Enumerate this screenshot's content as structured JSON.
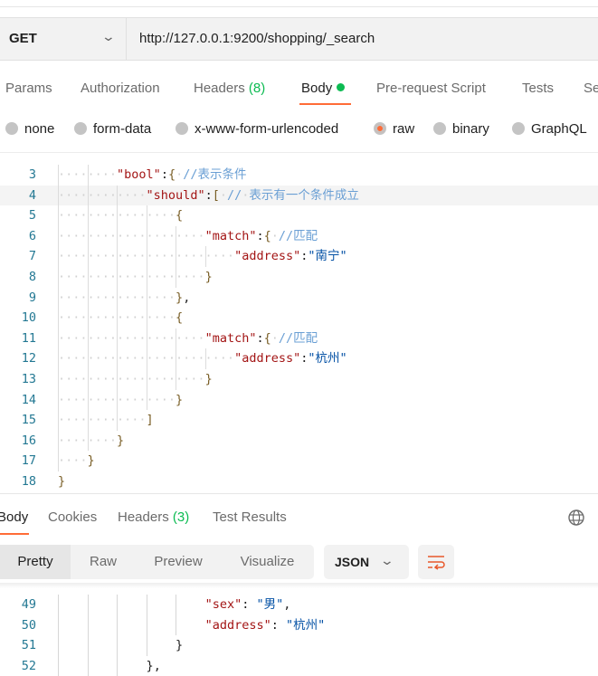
{
  "request": {
    "method": "GET",
    "url": "http://127.0.0.1:9200/shopping/_search",
    "tabs": [
      {
        "label": "Params"
      },
      {
        "label": "Authorization"
      },
      {
        "label": "Headers",
        "count": "(8)"
      },
      {
        "label": "Body",
        "active": true
      },
      {
        "label": "Pre-request Script"
      },
      {
        "label": "Tests"
      },
      {
        "label": "Se"
      }
    ],
    "body_types": [
      {
        "label": "none",
        "selected": false
      },
      {
        "label": "form-data",
        "selected": false
      },
      {
        "label": "x-www-form-urlencoded",
        "selected": false
      },
      {
        "label": "raw",
        "selected": true
      },
      {
        "label": "binary",
        "selected": false
      },
      {
        "label": "GraphQL",
        "selected": false
      }
    ],
    "code_lines": [
      {
        "n": "3",
        "indent": 8,
        "tokens": [
          [
            "k",
            "\"bool\""
          ],
          [
            "p",
            ":"
          ],
          [
            "b",
            "{"
          ],
          [
            "ws",
            " "
          ],
          [
            "c",
            "//表示条件"
          ]
        ]
      },
      {
        "n": "4",
        "indent": 12,
        "hl": true,
        "tokens": [
          [
            "k",
            "\"should\""
          ],
          [
            "p",
            ":"
          ],
          [
            "b",
            "["
          ],
          [
            "ws",
            " "
          ],
          [
            "c",
            "//"
          ],
          [
            "ws",
            " "
          ],
          [
            "c",
            "表示有一个条件成立"
          ]
        ]
      },
      {
        "n": "5",
        "indent": 16,
        "tokens": [
          [
            "b",
            "{"
          ]
        ]
      },
      {
        "n": "6",
        "indent": 20,
        "tokens": [
          [
            "k",
            "\"match\""
          ],
          [
            "p",
            ":"
          ],
          [
            "b",
            "{"
          ],
          [
            "ws",
            " "
          ],
          [
            "c",
            "//匹配"
          ]
        ]
      },
      {
        "n": "7",
        "indent": 24,
        "tokens": [
          [
            "k",
            "\"address\""
          ],
          [
            "p",
            ":"
          ],
          [
            "s",
            "\"南宁\""
          ]
        ]
      },
      {
        "n": "8",
        "indent": 20,
        "tokens": [
          [
            "b",
            "}"
          ]
        ]
      },
      {
        "n": "9",
        "indent": 16,
        "tokens": [
          [
            "b",
            "}"
          ],
          [
            "p",
            ","
          ]
        ]
      },
      {
        "n": "10",
        "indent": 16,
        "tokens": [
          [
            "b",
            "{"
          ]
        ]
      },
      {
        "n": "11",
        "indent": 20,
        "tokens": [
          [
            "k",
            "\"match\""
          ],
          [
            "p",
            ":"
          ],
          [
            "b",
            "{"
          ],
          [
            "ws",
            " "
          ],
          [
            "c",
            "//匹配"
          ]
        ]
      },
      {
        "n": "12",
        "indent": 24,
        "tokens": [
          [
            "k",
            "\"address\""
          ],
          [
            "p",
            ":"
          ],
          [
            "s",
            "\"杭州\""
          ]
        ]
      },
      {
        "n": "13",
        "indent": 20,
        "tokens": [
          [
            "b",
            "}"
          ]
        ]
      },
      {
        "n": "14",
        "indent": 16,
        "tokens": [
          [
            "b",
            "}"
          ]
        ]
      },
      {
        "n": "15",
        "indent": 12,
        "tokens": [
          [
            "b",
            "]"
          ]
        ]
      },
      {
        "n": "16",
        "indent": 8,
        "tokens": [
          [
            "b",
            "}"
          ]
        ]
      },
      {
        "n": "17",
        "indent": 4,
        "tokens": [
          [
            "b",
            "}"
          ]
        ]
      },
      {
        "n": "18",
        "indent": 0,
        "tokens": [
          [
            "b",
            "}"
          ]
        ]
      }
    ]
  },
  "response": {
    "tabs": [
      {
        "label": "Body",
        "active": true
      },
      {
        "label": "Cookies"
      },
      {
        "label": "Headers",
        "count": "(3)"
      },
      {
        "label": "Test Results"
      }
    ],
    "views": [
      "Pretty",
      "Raw",
      "Preview",
      "Visualize"
    ],
    "active_view": "Pretty",
    "format": "JSON",
    "code_lines": [
      {
        "n": "49",
        "indent": 20,
        "tokens": [
          [
            "k",
            "\"sex\""
          ],
          [
            "p",
            ": "
          ],
          [
            "s",
            "\"男\""
          ],
          [
            "p",
            ","
          ]
        ]
      },
      {
        "n": "50",
        "indent": 20,
        "tokens": [
          [
            "k",
            "\"address\""
          ],
          [
            "p",
            ": "
          ],
          [
            "s",
            "\"杭州\""
          ]
        ]
      },
      {
        "n": "51",
        "indent": 16,
        "tokens": [
          [
            "p",
            "}"
          ]
        ]
      },
      {
        "n": "52",
        "indent": 12,
        "tokens": [
          [
            "p",
            "}"
          ],
          [
            "p",
            ","
          ]
        ]
      }
    ]
  },
  "colors": {
    "accent": "#ff6c37",
    "count_green": "#0cbb52"
  }
}
